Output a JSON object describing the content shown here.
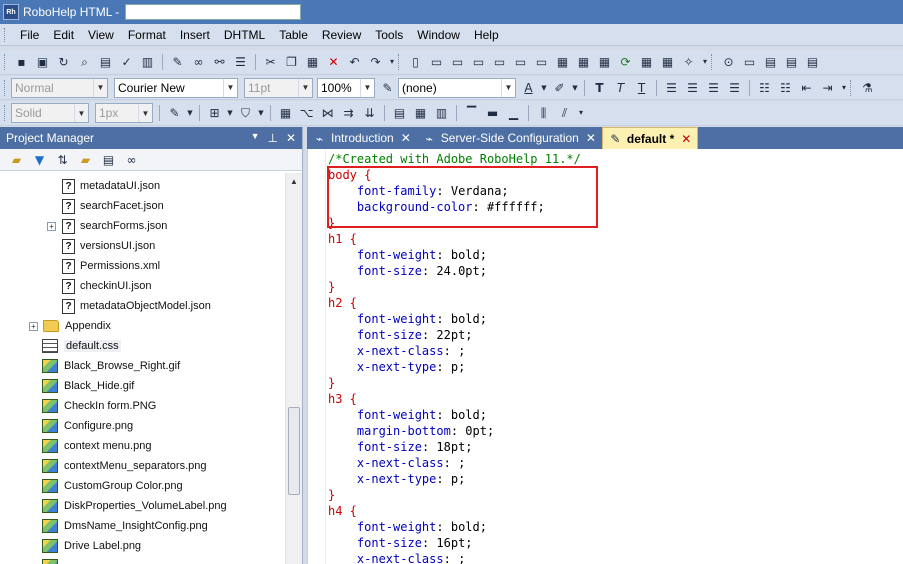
{
  "window": {
    "title": "RoboHelp HTML - ",
    "app_icon": "Rh"
  },
  "menu": [
    "File",
    "Edit",
    "View",
    "Format",
    "Insert",
    "DHTML",
    "Table",
    "Review",
    "Tools",
    "Window",
    "Help"
  ],
  "format_toolbar": {
    "style": "Normal",
    "font": "Courier New",
    "size": "11pt",
    "zoom": "100%",
    "class": "(none)"
  },
  "table_toolbar": {
    "border_style": "Solid",
    "border_width": "1px"
  },
  "project_manager": {
    "title": "Project Manager",
    "items": [
      {
        "label": "metadataUI.json",
        "type": "file"
      },
      {
        "label": "searchFacet.json",
        "type": "file"
      },
      {
        "label": "searchForms.json",
        "type": "file"
      },
      {
        "label": "versionsUI.json",
        "type": "file"
      },
      {
        "label": "Permissions.xml",
        "type": "file"
      },
      {
        "label": "checkinUI.json",
        "type": "file"
      },
      {
        "label": "metadataObjectModel.json",
        "type": "file"
      },
      {
        "label": "Appendix",
        "type": "folder"
      },
      {
        "label": "default.css",
        "type": "css"
      },
      {
        "label": "Black_Browse_Right.gif",
        "type": "image"
      },
      {
        "label": "Black_Hide.gif",
        "type": "image"
      },
      {
        "label": "CheckIn form.PNG",
        "type": "image"
      },
      {
        "label": "Configure.png",
        "type": "image"
      },
      {
        "label": "context menu.png",
        "type": "image"
      },
      {
        "label": "contextMenu_separators.png",
        "type": "image"
      },
      {
        "label": "CustomGroup Color.png",
        "type": "image"
      },
      {
        "label": "DiskProperties_VolumeLabel.png",
        "type": "image"
      },
      {
        "label": "DmsName_InsightConfig.png",
        "type": "image"
      },
      {
        "label": "Drive Label.png",
        "type": "image"
      }
    ]
  },
  "tabs": [
    {
      "label": "Introduction",
      "close": "✕"
    },
    {
      "label": "Server-Side Configuration",
      "close": "✕"
    },
    {
      "label": "default *",
      "close": "✕"
    }
  ],
  "code_lines": [
    {
      "t": "cmt",
      "text": "/*Created with Adobe RoboHelp 11.*/"
    },
    {
      "t": "sel",
      "text": "body {"
    },
    {
      "t": "decl",
      "prop": "font-family",
      "val": "Verdana;"
    },
    {
      "t": "decl",
      "prop": "background-color",
      "val": "#ffffff;"
    },
    {
      "t": "sel",
      "text": "}"
    },
    {
      "t": "sel",
      "text": "h1 {"
    },
    {
      "t": "decl",
      "prop": "font-weight",
      "val": "bold;"
    },
    {
      "t": "decl",
      "prop": "font-size",
      "val": "24.0pt;"
    },
    {
      "t": "sel",
      "text": "}"
    },
    {
      "t": "sel",
      "text": "h2 {"
    },
    {
      "t": "decl",
      "prop": "font-weight",
      "val": "bold;"
    },
    {
      "t": "decl",
      "prop": "font-size",
      "val": "22pt;"
    },
    {
      "t": "decl",
      "prop": "x-next-class",
      "val": ";"
    },
    {
      "t": "decl",
      "prop": "x-next-type",
      "val": "p;"
    },
    {
      "t": "sel",
      "text": "}"
    },
    {
      "t": "sel",
      "text": "h3 {"
    },
    {
      "t": "decl",
      "prop": "font-weight",
      "val": "bold;"
    },
    {
      "t": "decl",
      "prop": "margin-bottom",
      "val": "0pt;"
    },
    {
      "t": "decl",
      "prop": "font-size",
      "val": "18pt;"
    },
    {
      "t": "decl",
      "prop": "x-next-class",
      "val": ";"
    },
    {
      "t": "decl",
      "prop": "x-next-type",
      "val": "p;"
    },
    {
      "t": "sel",
      "text": "}"
    },
    {
      "t": "sel",
      "text": "h4 {"
    },
    {
      "t": "decl",
      "prop": "font-weight",
      "val": "bold;"
    },
    {
      "t": "decl",
      "prop": "font-size",
      "val": "16pt;"
    },
    {
      "t": "decl",
      "prop": "x-next-class",
      "val": ";"
    }
  ]
}
